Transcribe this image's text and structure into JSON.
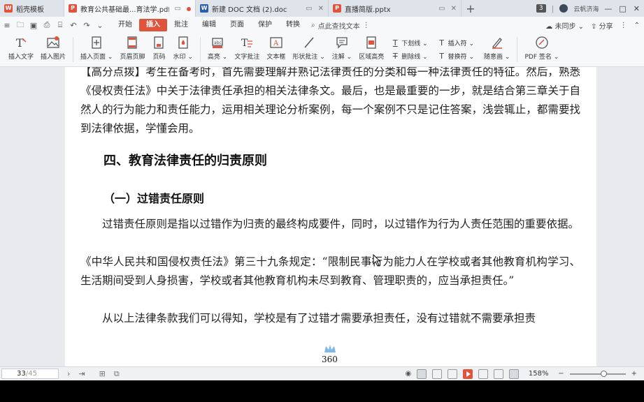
{
  "tabs": [
    {
      "label": "稻壳模板",
      "icon_color": "#e0533d",
      "icon": "docer-icon",
      "active": false
    },
    {
      "label": "教育公共基础最...育法学.pdf",
      "icon_color": "#e0533d",
      "icon": "pdf-icon",
      "active": true
    },
    {
      "label": "新建 DOC 文档 (2).doc",
      "icon_color": "#2b5ea8",
      "icon": "word-icon",
      "active": false
    },
    {
      "label": "直播简版.pptx",
      "icon_color": "#e0533d",
      "icon": "ppt-icon",
      "active": false
    }
  ],
  "window": {
    "count": "3",
    "user": "云帆济海"
  },
  "menu": {
    "items": [
      "开始",
      "插入",
      "批注",
      "编辑",
      "页面",
      "保护",
      "转换"
    ],
    "active": "插入",
    "search_label": "点此查找文本",
    "sync_label": "未同步",
    "share_label": "分享"
  },
  "ribbon": {
    "insert_text": "插入文字",
    "insert_image": "插入图片",
    "insert_page": "插入页面",
    "header_footer": "页眉页脚",
    "page_number": "页码",
    "watermark": "水印",
    "highlight": "高亮",
    "text_comment": "文字批注",
    "text_box": "文本框",
    "shape_comment": "形状批注",
    "annotation": "注解",
    "area_highlight": "区域高亮",
    "underline": "下划线",
    "strikethrough": "删除线",
    "insert_symbol": "插入符",
    "replace_symbol": "替换符",
    "freehand": "随意画",
    "pdf_sign": "PDF 签名"
  },
  "document": {
    "para1": "【高分点拨】考生在备考时，首先需要理解并熟记法律责任的分类和每一种法律责任的特征。然后，熟悉《侵权责任法》中关于法律责任承担的相关法律条文。最后，也是最重要的一步，就是结合第三章关于自然人的行为能力和责任能力，运用相关理论分析案例，每一个案例不只是记住答案，浅尝辄止，都需要找到法律依据，学懂会用。",
    "heading": "四、教育法律责任的归责原则",
    "subheading": "（一）过错责任原则",
    "para2": "过错责任原则是指以过错作为归责的最终构成要件，同时，以过错作为行为人责任范围的重要依据。",
    "para3": "《中华人民共和国侵权责任法》第三十九条规定：“限制民事行为能力人在学校或者其他教育机构学习、生活期间受到人身损害，学校或者其他教育机构未尽到教育、管理职责的，应当承担责任。”",
    "para4": "从以上法律条款我们可以得知，学校是有了过错才需要承担责任，没有过错就不需要承担责",
    "page_footer": "360"
  },
  "status": {
    "current_page": "33",
    "total_pages": "/45",
    "zoom": "158%"
  }
}
